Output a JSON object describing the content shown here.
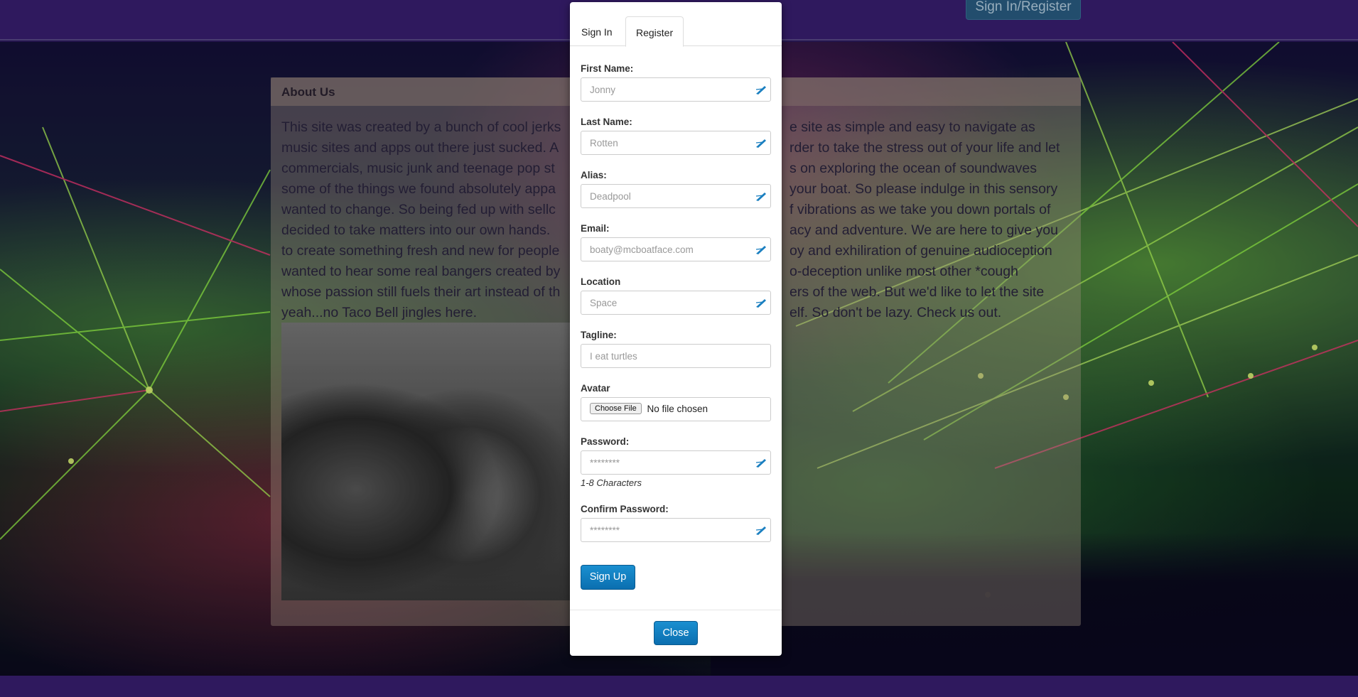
{
  "nav": {
    "signin_register_label": "Sign In/Register"
  },
  "about": {
    "title": "About Us",
    "lines": [
      "This site was created by a bunch of cool jerks",
      "music sites and apps out there just sucked. A",
      "commercials, music junk and teenage pop st",
      "some of the things we found absolutely appa",
      "wanted to change. So being fed up with sellc",
      "decided to take matters into our own hands.",
      "to create something fresh and new for people",
      "wanted to hear some real bangers created by",
      "whose passion still fuels their art instead of th",
      "yeah...no Taco Bell jingles here."
    ],
    "lines_right": [
      "e site as simple and easy to navigate as",
      "rder to take the stress out of your life and let",
      "s on exploring the ocean of soundwaves",
      "your boat. So please indulge in this sensory",
      "f vibrations as we take you down portals of",
      "acy and adventure. We are here to give you",
      "oy and exhiliration of genuine audioception",
      "o-deception unlike most other *cough",
      "ers of the web. But we'd like to let the site",
      "elf. So don't be lazy. Check us out."
    ]
  },
  "modal": {
    "tabs": [
      "Sign In",
      "Register"
    ],
    "active_tab": "Register",
    "fields": {
      "first_name": {
        "label": "First Name:",
        "placeholder": "Jonny"
      },
      "last_name": {
        "label": "Last Name:",
        "placeholder": "Rotten"
      },
      "alias": {
        "label": "Alias:",
        "placeholder": "Deadpool"
      },
      "email": {
        "label": "Email:",
        "placeholder": "boaty@mcboatface.com"
      },
      "location": {
        "label": "Location",
        "placeholder": "Space"
      },
      "tagline": {
        "label": "Tagline:",
        "placeholder": "I eat turtles"
      },
      "avatar": {
        "label": "Avatar",
        "button": "Choose File",
        "status": "No file chosen"
      },
      "password": {
        "label": "Password:",
        "placeholder": "********",
        "help": "1-8 Characters"
      },
      "confirm_password": {
        "label": "Confirm Password:",
        "placeholder": "********"
      }
    },
    "signup_label": "Sign Up",
    "close_label": "Close"
  },
  "colors": {
    "nav_bar": "#3a1f73",
    "button_blue": "#0b6fb0",
    "pen_icon": "#1a7fc0"
  },
  "icons": [
    "pen-icon"
  ]
}
